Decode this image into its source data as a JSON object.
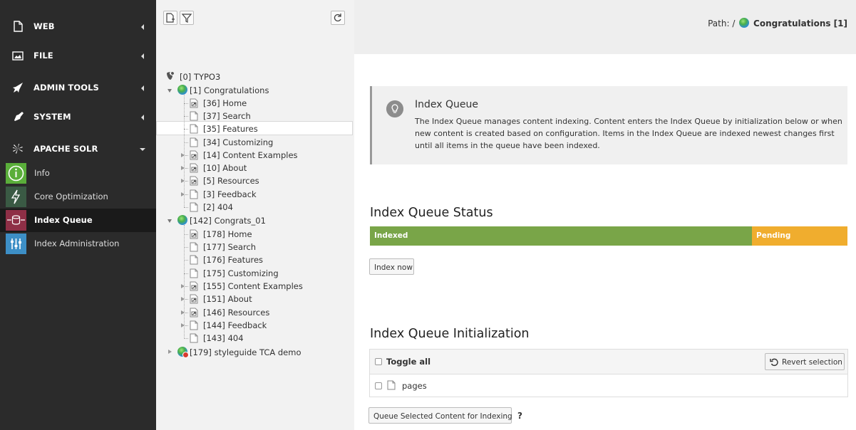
{
  "module_menu": {
    "groups": [
      {
        "label": "WEB",
        "icon": "page-icon"
      },
      {
        "label": "FILE",
        "icon": "image-icon"
      },
      {
        "label": "ADMIN TOOLS",
        "icon": "rocket-icon"
      },
      {
        "label": "SYSTEM",
        "icon": "plug-icon"
      },
      {
        "label": "APACHE SOLR",
        "icon": "solr-icon"
      }
    ],
    "solr_items": [
      {
        "label": "Info",
        "icon": "info-icon"
      },
      {
        "label": "Core Optimization",
        "icon": "lightning-icon"
      },
      {
        "label": "Index Queue",
        "icon": "index-queue-icon"
      },
      {
        "label": "Index Administration",
        "icon": "sliders-icon"
      }
    ]
  },
  "tree": {
    "root": "[0] TYPO3",
    "nodes": [
      "[1] Congratulations",
      "[36] Home",
      "[37] Search",
      "[35] Features",
      "[34] Customizing",
      "[14] Content Examples",
      "[10] About",
      "[5] Resources",
      "[3] Feedback",
      "[2] 404",
      "[142] Congrats_01",
      "[178] Home",
      "[177] Search",
      "[176] Features",
      "[175] Customizing",
      "[155] Content Examples",
      "[151] About",
      "[146] Resources",
      "[144] Feedback",
      "[143] 404",
      "[179] styleguide TCA demo"
    ]
  },
  "topbar": {
    "path_prefix": "Path: /",
    "path_page": "Congratulations [1]"
  },
  "info": {
    "title": "Index Queue",
    "text": "The Index Queue manages content indexing. Content enters the Index Queue by initialization below or when new content is created based on configuration. Items in the Index Queue are indexed newest changes first until all items in the queue have been indexed."
  },
  "status": {
    "title": "Index Queue Status",
    "indexed_label": "Indexed",
    "pending_label": "Pending",
    "indexed_fraction": 0.8,
    "indexed_color": "#79a548",
    "pending_color": "#f0ad2e",
    "index_now_label": "Index now"
  },
  "initialization": {
    "title": "Index Queue Initialization",
    "toggle_all_label": "Toggle all",
    "revert_label": "Revert selection",
    "rows": [
      "pages"
    ],
    "queue_button_label": "Queue Selected Content for Indexing",
    "help_label": "?"
  }
}
